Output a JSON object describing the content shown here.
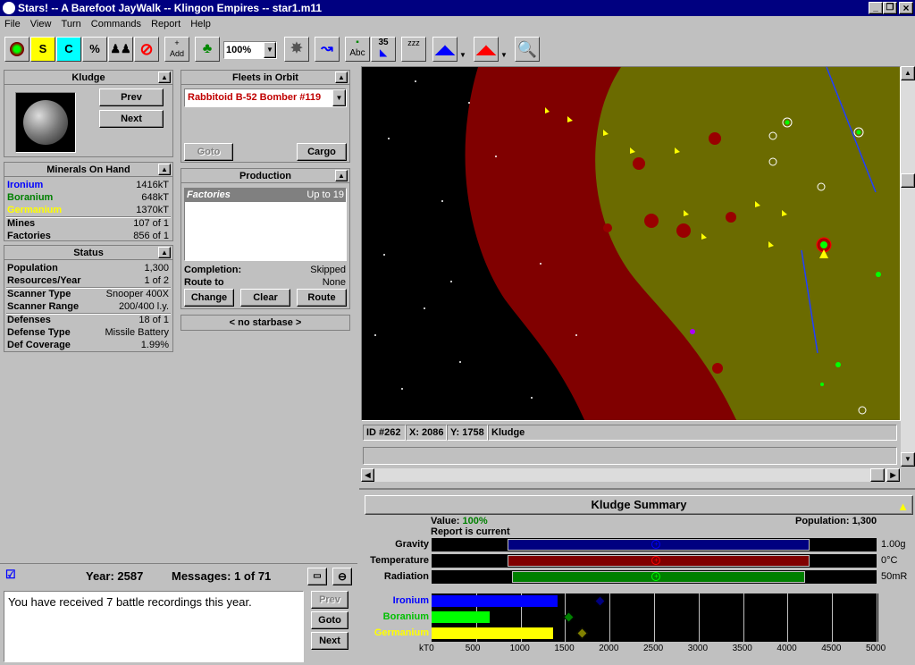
{
  "window": {
    "title": "Stars! -- A Barefoot JayWalk -- Klingon Empires -- star1.m11",
    "min": "_",
    "max": "❐",
    "close": "×"
  },
  "menu": [
    "File",
    "View",
    "Turn",
    "Commands",
    "Report",
    "Help"
  ],
  "toolbar": {
    "zoom": "100%",
    "add": "Add",
    "abc": "Abc",
    "num": "35",
    "s_letter": "S",
    "c_letter": "C",
    "percent": "%",
    "zzz": "zzz"
  },
  "planet": {
    "name": "Kludge",
    "prev": "Prev",
    "next": "Next"
  },
  "fleets": {
    "title": "Fleets in Orbit",
    "selected": "Rabbitoid B-52 Bomber #119",
    "goto": "Goto",
    "cargo": "Cargo"
  },
  "minerals": {
    "title": "Minerals On Hand",
    "ironium_label": "Ironium",
    "ironium": "1416kT",
    "boranium_label": "Boranium",
    "boranium": "648kT",
    "germanium_label": "Germanium",
    "germanium": "1370kT",
    "mines_label": "Mines",
    "mines": "107 of 1",
    "factories_label": "Factories",
    "factories": "856 of 1"
  },
  "production": {
    "title": "Production",
    "item": "Factories",
    "item_qty": "Up to 19",
    "completion_label": "Completion:",
    "completion": "Skipped",
    "route_label": "Route to",
    "route": "None",
    "change": "Change",
    "clear": "Clear",
    "route_btn": "Route"
  },
  "status": {
    "title": "Status",
    "rows": [
      {
        "k": "Population",
        "v": "1,300"
      },
      {
        "k": "Resources/Year",
        "v": "1 of 2"
      },
      {
        "k": "Scanner Type",
        "v": "Snooper 400X"
      },
      {
        "k": "Scanner Range",
        "v": "200/400 l.y."
      },
      {
        "k": "Defenses",
        "v": "18 of 1"
      },
      {
        "k": "Defense Type",
        "v": "Missile Battery"
      },
      {
        "k": "Def Coverage",
        "v": "1.99%"
      }
    ]
  },
  "starbase": {
    "title": "< no starbase >"
  },
  "coords": {
    "id": "ID #262",
    "x": "X: 2086",
    "y": "Y: 1758",
    "name": "Kludge"
  },
  "messages": {
    "year": "Year: 2587",
    "count": "Messages: 1 of 71",
    "text": "You have received 7 battle recordings this year.",
    "prev": "Prev",
    "goto": "Goto",
    "next": "Next"
  },
  "summary": {
    "title": "Kludge Summary",
    "value_label": "Value:",
    "value": "100%",
    "report": "Report is current",
    "population_label": "Population:",
    "population": "1,300",
    "env": [
      {
        "label": "Gravity",
        "value": "1.00g",
        "color": "#000080",
        "knob": "#0000ff",
        "start": 0.17,
        "end": 0.85,
        "pos": 0.505
      },
      {
        "label": "Temperature",
        "value": "0°C",
        "color": "#800000",
        "knob": "#ff0000",
        "start": 0.17,
        "end": 0.85,
        "pos": 0.505
      },
      {
        "label": "Radiation",
        "value": "50mR",
        "color": "#008000",
        "knob": "#00ff00",
        "start": 0.18,
        "end": 0.84,
        "pos": 0.505
      }
    ],
    "minerals": [
      {
        "label": "Ironium",
        "labelColor": "#0000ff",
        "amount": 1416,
        "conc": 1900,
        "color": "#0000ff"
      },
      {
        "label": "Boranium",
        "labelColor": "#00c000",
        "amount": 648,
        "conc": 1550,
        "color": "#00ff00",
        "diamond": "#008000"
      },
      {
        "label": "Germanium",
        "labelColor": "#ffff00",
        "amount": 1370,
        "conc": 1700,
        "color": "#ffff00",
        "diamond": "#808000"
      }
    ],
    "axis": [
      "kT0",
      "500",
      "1000",
      "1500",
      "2000",
      "2500",
      "3000",
      "3500",
      "4000",
      "4500",
      "5000"
    ],
    "axis_max": 5000
  }
}
